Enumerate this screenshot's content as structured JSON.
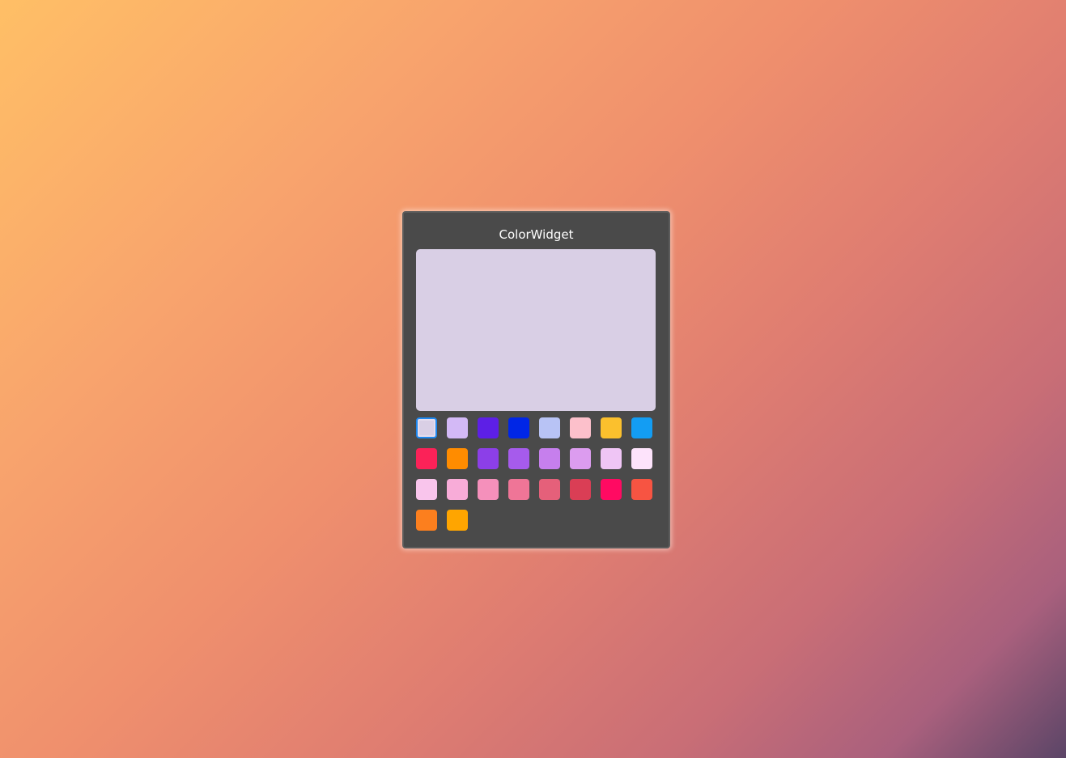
{
  "widget": {
    "title": "ColorWidget",
    "preview_color": "#d9cfe5",
    "selected_index": 0
  },
  "swatches": [
    "#d9cfe5",
    "#d3b9f6",
    "#5d1fe6",
    "#0026e6",
    "#b8c3f5",
    "#fcc0cb",
    "#fbc02d",
    "#139df3",
    "#fb2258",
    "#ff8c00",
    "#8c3fe8",
    "#a65bec",
    "#c67fed",
    "#dc9cef",
    "#efc5f5",
    "#fde3fb",
    "#f9c5ec",
    "#f8acd8",
    "#f590bb",
    "#ef7597",
    "#e5607a",
    "#da3e55",
    "#ff0a62",
    "#f75442",
    "#fc7f1e",
    "#ffa500"
  ]
}
